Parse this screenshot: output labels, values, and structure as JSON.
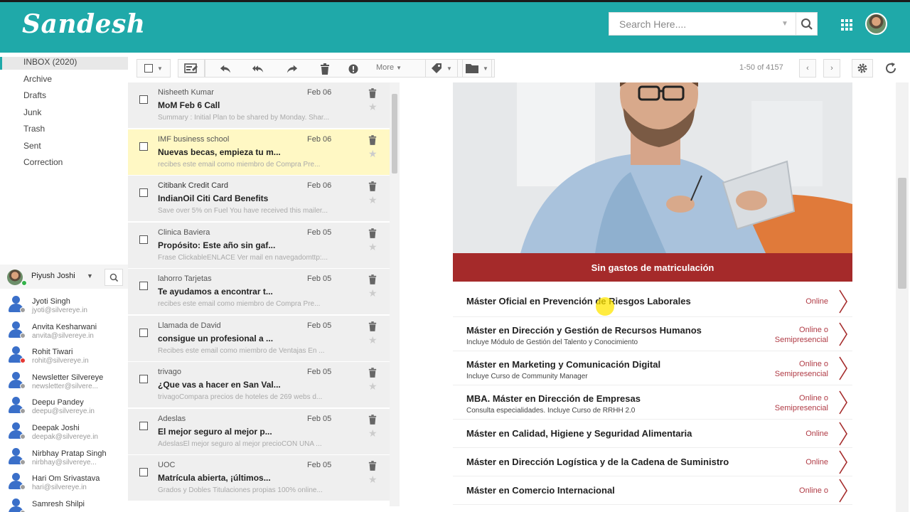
{
  "theme": {
    "teal": "#1fa9a9",
    "accent_red": "#a52a2a"
  },
  "header": {
    "logo": "Sandesh",
    "search_placeholder": "Search Here...."
  },
  "folders": [
    {
      "label": "INBOX  (2020)",
      "active": true
    },
    {
      "label": "Archive"
    },
    {
      "label": "Drafts"
    },
    {
      "label": "Junk"
    },
    {
      "label": "Trash"
    },
    {
      "label": "Sent"
    },
    {
      "label": "Correction"
    }
  ],
  "user": {
    "name": "Piyush Joshi"
  },
  "contacts": [
    {
      "name": "Jyoti Singh",
      "email": "jyoti@silvereye.in",
      "status": "#9e9e9e"
    },
    {
      "name": "Anvita Kesharwani",
      "email": "anvita@silvereye.in",
      "status": "#9e9e9e"
    },
    {
      "name": "Rohit Tiwari",
      "email": "rohit@silvereye.in",
      "status": "#e53935"
    },
    {
      "name": "Newsletter Silvereye",
      "email": "newsletter@silvere...",
      "status": "#9e9e9e"
    },
    {
      "name": "Deepu Pandey",
      "email": "deepu@silvereye.in",
      "status": "#9e9e9e"
    },
    {
      "name": "Deepak Joshi",
      "email": "deepak@silvereye.in",
      "status": "#9e9e9e"
    },
    {
      "name": "Nirbhay Pratap Singh",
      "email": "nirbhay@silvereye...",
      "status": "#9e9e9e"
    },
    {
      "name": "Hari Om Srivastava",
      "email": "hari@silvereye.in",
      "status": "#9e9e9e"
    },
    {
      "name": "Samresh Shilpi",
      "email": "",
      "status": "#9e9e9e"
    }
  ],
  "toolbar": {
    "more_label": "More",
    "pager": "1-50 of 4157"
  },
  "mails": [
    {
      "from": "Nisheeth Kumar",
      "date": "Feb 06",
      "subject": "MoM Feb 6 Call",
      "snippet": "Summary : Initial Plan to be shared by Monday. Shar...",
      "highlight": false
    },
    {
      "from": "IMF business school",
      "date": "Feb 06",
      "subject": "Nuevas becas, empieza tu m...",
      "snippet": "recibes este email como miembro de Compra Pre...",
      "highlight": true
    },
    {
      "from": "Citibank Credit Card",
      "date": "Feb 06",
      "subject": "IndianOil Citi Card Benefits",
      "snippet": "Save over 5% on Fuel You have received this mailer...",
      "highlight": false
    },
    {
      "from": "Clinica Baviera",
      "date": "Feb 05",
      "subject": "Propósito: Este año sin gaf...",
      "snippet": "Frase ClickableENLACE Ver mail en navegadomttp:...",
      "highlight": false
    },
    {
      "from": "lahorro Tarjetas",
      "date": "Feb 05",
      "subject": "Te ayudamos a encontrar t...",
      "snippet": "recibes este email como miembro de Compra Pre...",
      "highlight": false
    },
    {
      "from": "Llamada de David",
      "date": "Feb 05",
      "subject": "consigue un profesional a ...",
      "snippet": "Recibes este email como miembro de Ventajas En ...",
      "highlight": false
    },
    {
      "from": "trivago",
      "date": "Feb 05",
      "subject": "¿Que vas a hacer en San Val...",
      "snippet": "trivagoCompara precios de hoteles de 269 webs d...",
      "highlight": false
    },
    {
      "from": "Adeslas",
      "date": "Feb 05",
      "subject": "El mejor seguro al mejor p...",
      "snippet": "AdeslasEl mejor seguro al mejor precioCON UNA ...",
      "highlight": false
    },
    {
      "from": "UOC",
      "date": "Feb 05",
      "subject": "Matrícula abierta, ¡últimos...",
      "snippet": "Grados y Dobles Titulaciones propias 100% online...",
      "highlight": false
    }
  ],
  "email": {
    "banner": "Sin gastos de matriculación",
    "courses": [
      {
        "title": "Máster Oficial en Prevención de Riesgos Laborales",
        "subtitle": "",
        "mode": [
          "Online"
        ]
      },
      {
        "title": "Máster en Dirección y Gestión de Recursos Humanos",
        "subtitle": "Incluye Módulo de Gestión del Talento y Conocimiento",
        "mode": [
          "Online o",
          "Semipresencial"
        ]
      },
      {
        "title": "Máster en Marketing y Comunicación Digital",
        "subtitle": "Incluye Curso de Community Manager",
        "mode": [
          "Online o",
          "Semipresencial"
        ]
      },
      {
        "title": "MBA. Máster en Dirección de Empresas",
        "subtitle": "Consulta especialidades. Incluye Curso de RRHH 2.0",
        "mode": [
          "Online o",
          "Semipresencial"
        ]
      },
      {
        "title": "Máster en Calidad, Higiene y Seguridad Alimentaria",
        "subtitle": "",
        "mode": [
          "Online"
        ]
      },
      {
        "title": "Máster en Dirección Logística y de la Cadena de Suministro",
        "subtitle": "",
        "mode": [
          "Online"
        ]
      },
      {
        "title": "Máster en Comercio Internacional",
        "subtitle": "",
        "mode": [
          "Online o"
        ]
      }
    ]
  }
}
